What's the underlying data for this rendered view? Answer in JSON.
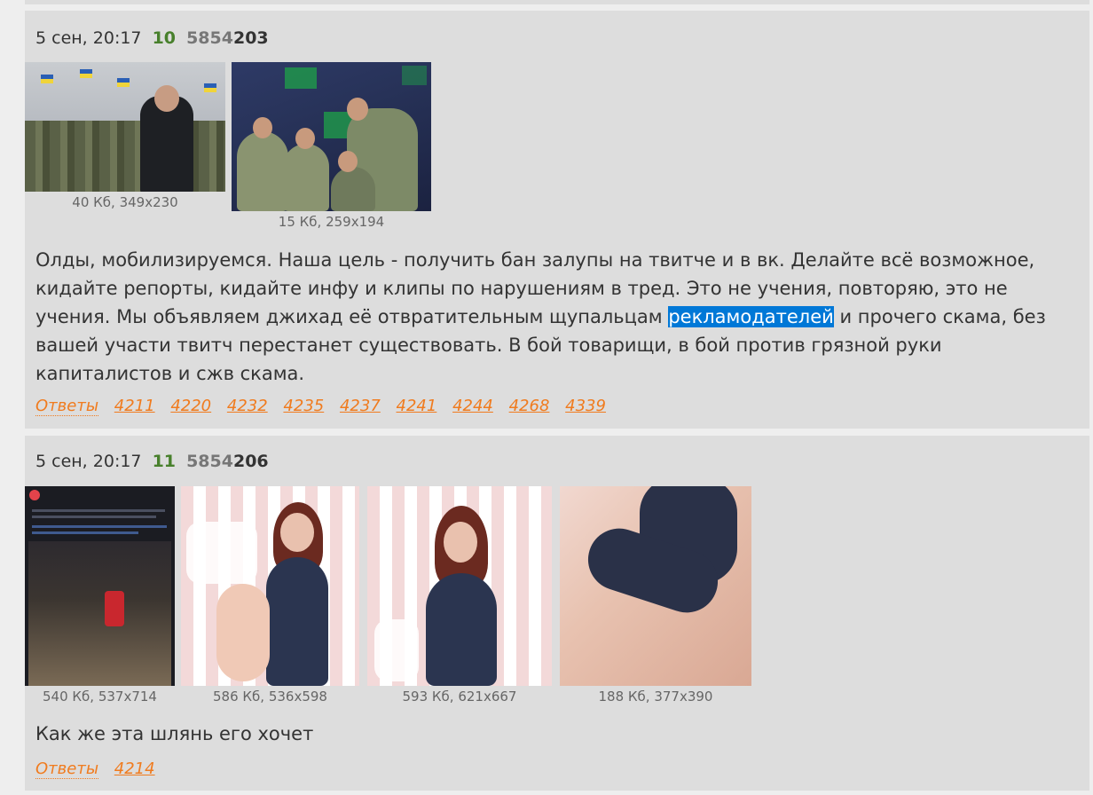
{
  "posts": [
    {
      "date": "5 сен, 20:17",
      "index": "10",
      "num_prefix": "5854",
      "num_suffix": "203",
      "files": [
        {
          "meta": "40 Кб, 349x230",
          "icon": "army-parade-thumbnail"
        },
        {
          "meta": "15 Кб, 259x194",
          "icon": "operations-room-thumbnail"
        }
      ],
      "message_before": "Олды, мобилизируемся. Наша цель - получить бан залупы на твитче и в вк. Делайте всё возможное, кидайте репорты, кидайте инфу и клипы по нарушениям в тред. Это не учения, повторяю, это не учения. Мы объявляем джихад её отвратительным щупальцам ",
      "message_highlight": "рекламодателей",
      "message_after": " и прочего скама, без вашей участи твитч перестанет существовать. В бой товарищи, в бой против грязной руки капиталистов и сжв скама.",
      "replies_label": "Ответы",
      "replies": [
        "4211",
        "4220",
        "4232",
        "4235",
        "4237",
        "4241",
        "4244",
        "4268",
        "4339"
      ]
    },
    {
      "date": "5 сен, 20:17",
      "index": "11",
      "num_prefix": "5854",
      "num_suffix": "206",
      "files": [
        {
          "meta": "540 Кб, 537x714",
          "icon": "dark-post-screenshot-thumbnail"
        },
        {
          "meta": "586 Кб, 536x598",
          "icon": "stream-frame-thumbnail"
        },
        {
          "meta": "593 Кб, 621x667",
          "icon": "stream-frame-thumbnail"
        },
        {
          "meta": "188 Кб, 377x390",
          "icon": "stream-closeup-thumbnail"
        }
      ],
      "message": "Как же эта шлянь его хочет",
      "replies_label": "Ответы",
      "replies": [
        "4214"
      ]
    }
  ],
  "colors": {
    "background": "#eeeeee",
    "post_bg": "#dddddd",
    "index_green": "#48802c",
    "link_orange": "#f07b1e",
    "selection_blue": "#0078d7"
  }
}
